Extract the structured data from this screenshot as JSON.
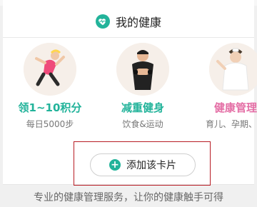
{
  "header": {
    "title": "我的健康"
  },
  "items": [
    {
      "title": "领1~10积分",
      "subtitle": "每日5000步",
      "title_color": "#22b39a"
    },
    {
      "title": "减重健身",
      "subtitle": "饮食&运动",
      "title_color": "#22b39a"
    },
    {
      "title": "健康管理",
      "subtitle": "育儿、孕期、体",
      "title_color": "#e46ea5"
    }
  ],
  "add_card": {
    "label": "添加该卡片"
  },
  "footer": {
    "text": "专业的健康管理服务，让你的健康触手可得"
  },
  "colors": {
    "accent": "#22b39a",
    "highlight_border": "#b81c24",
    "pink": "#e46ea5"
  },
  "icons": {
    "header_logo": "heart-pulse-icon",
    "add": "plus-circle-icon"
  }
}
